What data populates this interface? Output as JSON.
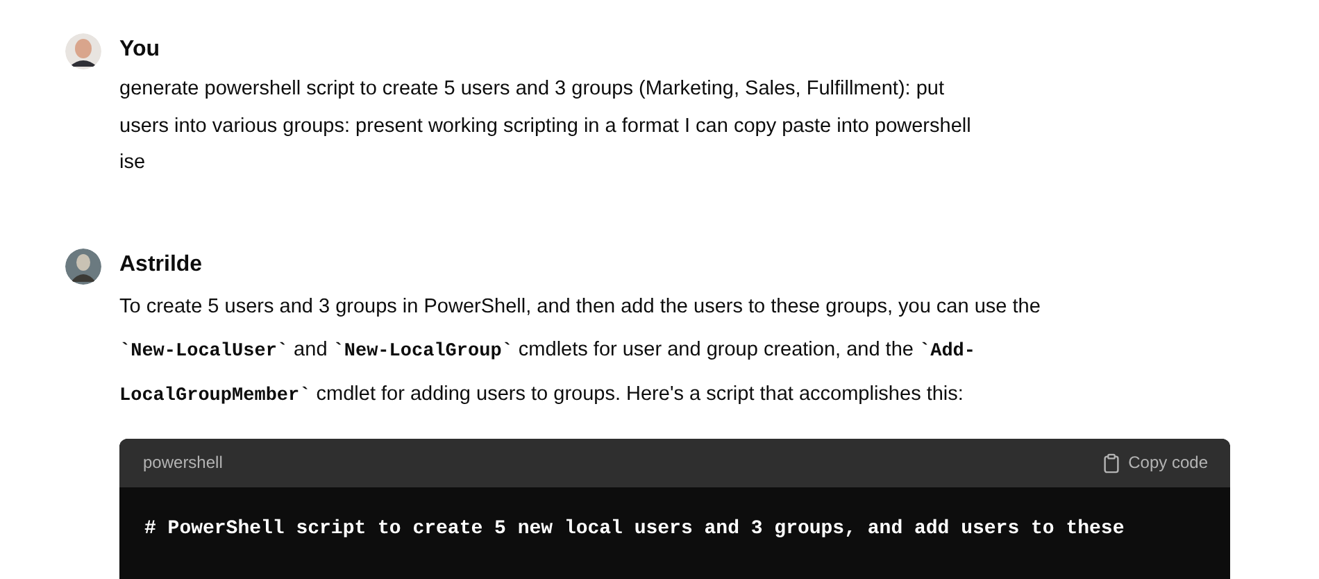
{
  "messages": [
    {
      "author": "You",
      "kind": "user",
      "lines": [
        [
          {
            "kind": "text",
            "text": "generate powershell script to create 5 users and 3 groups (Marketing, Sales, Fulfillment): put"
          }
        ],
        [
          {
            "kind": "text",
            "text": "users into various groups: present working scripting in a format I can copy paste into powershell"
          }
        ],
        [
          {
            "kind": "text",
            "text": "ise"
          }
        ]
      ]
    },
    {
      "author": "Astrilde",
      "kind": "assistant",
      "lines": [
        [
          {
            "kind": "text",
            "text": "To create 5 users and 3 groups in PowerShell, and then add the users to these groups, you can use the"
          }
        ],
        [
          {
            "kind": "code",
            "text": "`New-LocalUser`"
          },
          {
            "kind": "text",
            "text": " and "
          },
          {
            "kind": "code",
            "text": "`New-LocalGroup`"
          },
          {
            "kind": "text",
            "text": " cmdlets for user and group creation, and the "
          },
          {
            "kind": "code",
            "text": "`Add-"
          }
        ],
        [
          {
            "kind": "code",
            "text": "LocalGroupMember`"
          },
          {
            "kind": "text",
            "text": " cmdlet for adding users to groups. Here's a script that accomplishes this:"
          }
        ]
      ],
      "code_block": {
        "language": "powershell",
        "copy_label": "Copy code",
        "lines": [
          "# PowerShell script to create 5 new local users and 3 groups, and add users to these"
        ]
      }
    }
  ]
}
